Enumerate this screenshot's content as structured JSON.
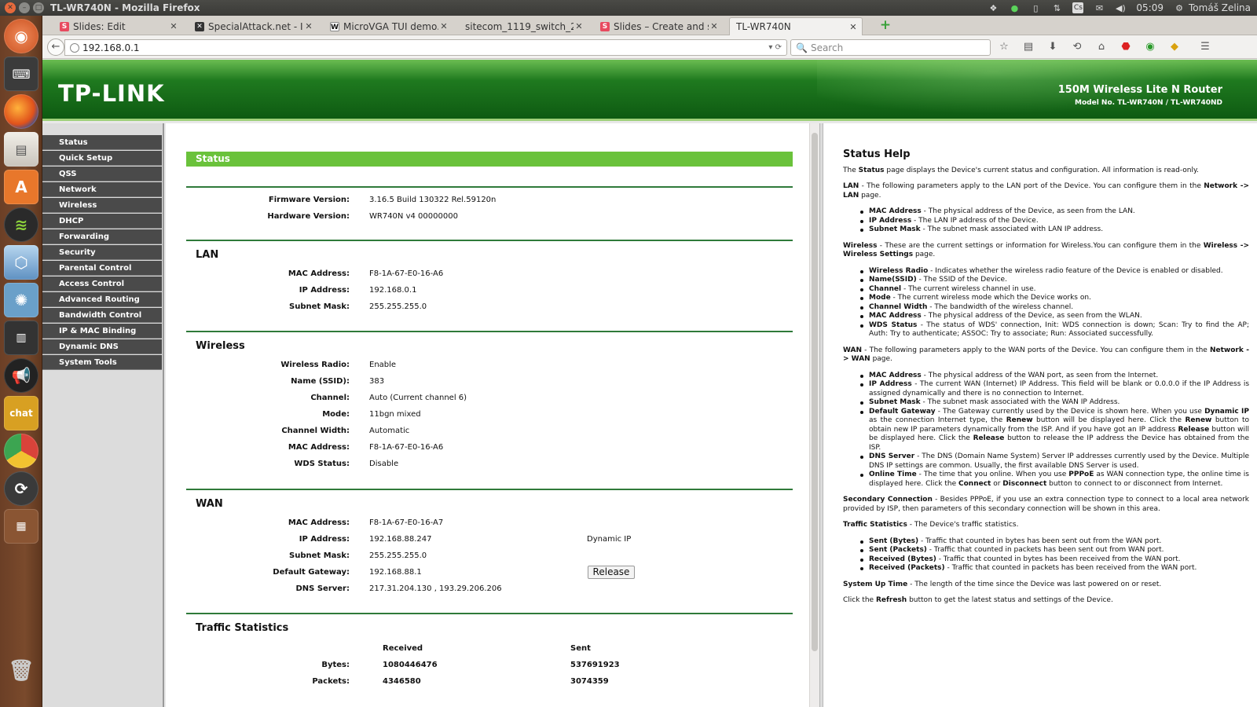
{
  "os": {
    "title": "TL-WR740N - Mozilla Firefox",
    "time": "05:09",
    "user": "Tomáš Zelina"
  },
  "launcher": {
    "icons": [
      "ubuntu-dash-icon",
      "keyboard-icon",
      "firefox-icon",
      "files-icon",
      "software-center-icon",
      "spotify-icon",
      "virtualbox-icon",
      "pinwheel-icon",
      "equalizer-icon",
      "megaphone-icon",
      "chat-icon",
      "chrome-icon",
      "update-icon",
      "workspaces-icon",
      "trash-icon"
    ]
  },
  "tabs": [
    {
      "label": "Slides: Edit",
      "fav": "S"
    },
    {
      "label": "SpecialAttack.net - I...",
      "fav": "✕"
    },
    {
      "label": "MicroVGA TUI demo...",
      "fav": "W"
    },
    {
      "label": "sitecom_1119_switch_2...",
      "fav": ""
    },
    {
      "label": "Slides – Create and s...",
      "fav": "S"
    },
    {
      "label": "TL-WR740N",
      "fav": ""
    }
  ],
  "nav": {
    "url": "192.168.0.1",
    "search_placeholder": "Search"
  },
  "router": {
    "logo": "TP-LINK",
    "model_title": "150M Wireless Lite N Router",
    "model_no": "Model No. TL-WR740N / TL-WR740ND"
  },
  "menu": [
    "Status",
    "Quick Setup",
    "QSS",
    "Network",
    "Wireless",
    "DHCP",
    "Forwarding",
    "Security",
    "Parental Control",
    "Access Control",
    "Advanced Routing",
    "Bandwidth Control",
    "IP & MAC Binding",
    "Dynamic DNS",
    "System Tools"
  ],
  "status": {
    "heading": "Status",
    "firmware_label": "Firmware Version:",
    "firmware": "3.16.5 Build 130322 Rel.59120n",
    "hardware_label": "Hardware Version:",
    "hardware": "WR740N v4 00000000",
    "lan": {
      "title": "LAN",
      "mac_label": "MAC Address:",
      "mac": "F8-1A-67-E0-16-A6",
      "ip_label": "IP Address:",
      "ip": "192.168.0.1",
      "mask_label": "Subnet Mask:",
      "mask": "255.255.255.0"
    },
    "wireless": {
      "title": "Wireless",
      "radio_label": "Wireless Radio:",
      "radio": "Enable",
      "ssid_label": "Name (SSID):",
      "ssid": "383",
      "channel_label": "Channel:",
      "channel": "Auto (Current channel 6)",
      "mode_label": "Mode:",
      "mode": "11bgn mixed",
      "width_label": "Channel Width:",
      "width": "Automatic",
      "mac_label": "MAC Address:",
      "mac": "F8-1A-67-E0-16-A6",
      "wds_label": "WDS Status:",
      "wds": "Disable"
    },
    "wan": {
      "title": "WAN",
      "mac_label": "MAC Address:",
      "mac": "F8-1A-67-E0-16-A7",
      "ip_label": "IP Address:",
      "ip": "192.168.88.247",
      "ip_type": "Dynamic IP",
      "mask_label": "Subnet Mask:",
      "mask": "255.255.255.0",
      "gw_label": "Default Gateway:",
      "gw": "192.168.88.1",
      "release_label": "Release",
      "dns_label": "DNS Server:",
      "dns": "217.31.204.130 , 193.29.206.206"
    },
    "traffic": {
      "title": "Traffic Statistics",
      "received_header": "Received",
      "sent_header": "Sent",
      "bytes_label": "Bytes:",
      "bytes_received": "1080446476",
      "bytes_sent": "537691923",
      "packets_label": "Packets:",
      "packets_received": "4346580",
      "packets_sent": "3074359"
    }
  },
  "help": {
    "title": "Status Help"
  }
}
